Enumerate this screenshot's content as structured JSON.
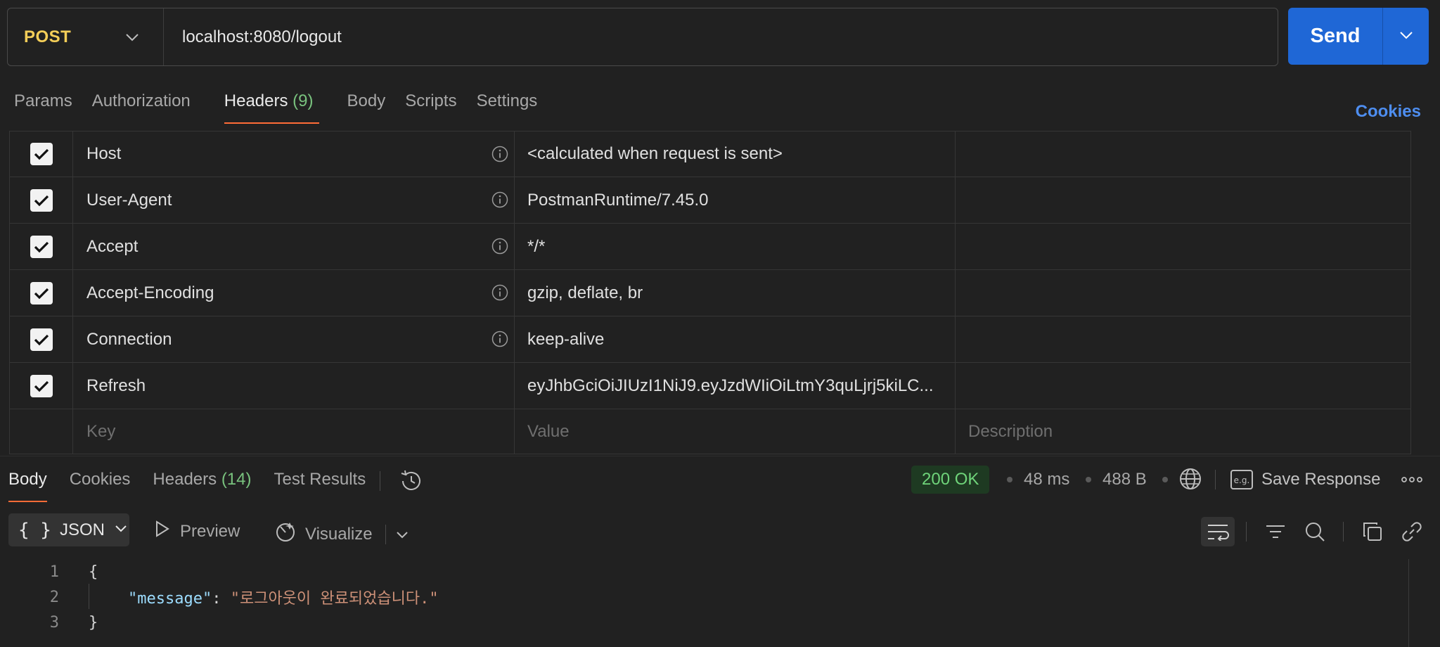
{
  "request": {
    "method": "POST",
    "url": "localhost:8080/logout",
    "send_label": "Send"
  },
  "request_tabs": [
    {
      "label": "Params"
    },
    {
      "label": "Authorization"
    },
    {
      "label": "Headers",
      "count": "(9)"
    },
    {
      "label": "Body"
    },
    {
      "label": "Scripts"
    },
    {
      "label": "Settings"
    }
  ],
  "cookies_link": "Cookies",
  "headers_table": {
    "rows": [
      {
        "key": "Host",
        "value": "<calculated when request is sent>"
      },
      {
        "key": "User-Agent",
        "value": "PostmanRuntime/7.45.0"
      },
      {
        "key": "Accept",
        "value": "*/*"
      },
      {
        "key": "Accept-Encoding",
        "value": "gzip, deflate, br"
      },
      {
        "key": "Connection",
        "value": "keep-alive"
      },
      {
        "key": "Refresh",
        "value": "eyJhbGciOiJIUzI1NiJ9.eyJzdWIiOiLtmY3quLjrj5kiLC..."
      }
    ],
    "placeholders": {
      "key": "Key",
      "value": "Value",
      "description": "Description"
    }
  },
  "response_tabs": [
    {
      "label": "Body"
    },
    {
      "label": "Cookies"
    },
    {
      "label": "Headers",
      "count": "(14)"
    },
    {
      "label": "Test Results"
    }
  ],
  "response_meta": {
    "status": "200 OK",
    "time": "48 ms",
    "size": "488 B",
    "save_label": "Save Response"
  },
  "response_toolbar": {
    "format": "JSON",
    "preview": "Preview",
    "visualize": "Visualize"
  },
  "response_body": {
    "line_numbers": [
      "1",
      "2",
      "3"
    ],
    "open_brace": "{",
    "key": "\"message\"",
    "colon": ": ",
    "value": "\"로그아웃이 완료되었습니다.\"",
    "close_brace": "}"
  },
  "colors": {
    "method": "#f4ce58",
    "send": "#1f67d6",
    "accent_underline": "#ff6c37",
    "status_ok": "#6fd47a",
    "link": "#4e8ef0"
  }
}
